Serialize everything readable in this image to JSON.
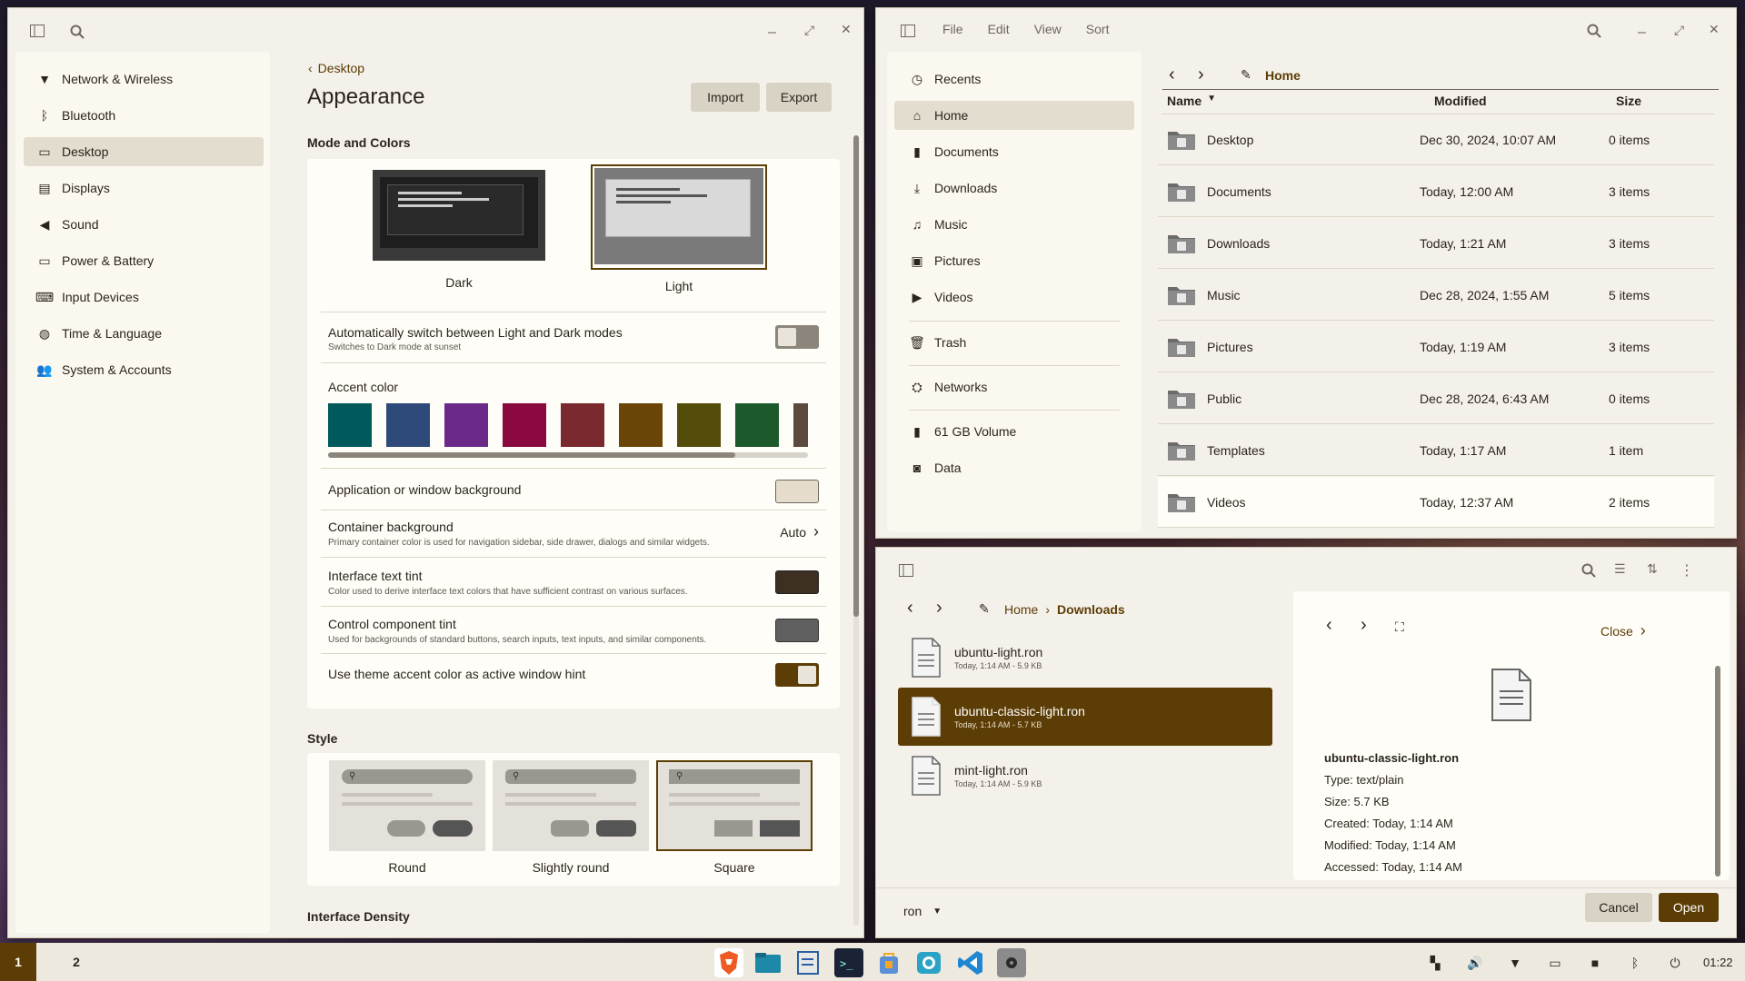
{
  "settings": {
    "nav": [
      {
        "label": "Network & Wireless",
        "icon": "wifi-icon"
      },
      {
        "label": "Bluetooth",
        "icon": "bluetooth-icon"
      },
      {
        "label": "Desktop",
        "icon": "desktop-icon"
      },
      {
        "label": "Displays",
        "icon": "displays-icon"
      },
      {
        "label": "Sound",
        "icon": "sound-icon"
      },
      {
        "label": "Power & Battery",
        "icon": "battery-icon"
      },
      {
        "label": "Input Devices",
        "icon": "keyboard-icon"
      },
      {
        "label": "Time & Language",
        "icon": "globe-icon"
      },
      {
        "label": "System & Accounts",
        "icon": "accounts-icon"
      }
    ],
    "selected_nav": "Desktop",
    "breadcrumb": "Desktop",
    "title": "Appearance",
    "import_label": "Import",
    "export_label": "Export",
    "mode_section": "Mode and Colors",
    "mode_dark": "Dark",
    "mode_light": "Light",
    "selected_mode": "Light",
    "auto_switch_title": "Automatically switch between Light and Dark modes",
    "auto_switch_sub": "Switches to Dark mode at sunset",
    "auto_switch_on": false,
    "accent_label": "Accent color",
    "accent_colors": [
      "#005a5c",
      "#2e4a7a",
      "#6b2a8a",
      "#8a0a3f",
      "#7a2a2e",
      "#6b4507",
      "#544c0a",
      "#1c5a2c",
      "#5c4a3e"
    ],
    "app_bg_label": "Application or window background",
    "app_bg_color": "#e5dccb",
    "container_title": "Container background",
    "container_sub": "Primary container color is used for navigation sidebar, side drawer, dialogs and similar widgets.",
    "container_value": "Auto",
    "text_tint_title": "Interface text tint",
    "text_tint_sub": "Color used to derive interface text colors that have sufficient contrast on various surfaces.",
    "text_tint_color": "#3d3023",
    "control_tint_title": "Control component tint",
    "control_tint_sub": "Used for backgrounds of standard buttons, search inputs, text inputs, and similar components.",
    "control_tint_color": "#5f5f5f",
    "theme_hint_label": "Use theme accent color as active window hint",
    "theme_hint_on": true,
    "style_section": "Style",
    "styles": [
      "Round",
      "Slightly round",
      "Square"
    ],
    "selected_style": "Square",
    "density_section": "Interface Density"
  },
  "files": {
    "menu": [
      "File",
      "Edit",
      "View",
      "Sort"
    ],
    "sidebar": [
      {
        "label": "Recents",
        "icon": "recents-icon"
      },
      {
        "label": "Home",
        "icon": "home-icon"
      },
      {
        "label": "Documents",
        "icon": "documents-icon"
      },
      {
        "label": "Downloads",
        "icon": "downloads-icon"
      },
      {
        "label": "Music",
        "icon": "music-icon"
      },
      {
        "label": "Pictures",
        "icon": "pictures-icon"
      },
      {
        "label": "Videos",
        "icon": "videos-icon"
      },
      {
        "label": "Trash",
        "icon": "trash-icon"
      },
      {
        "label": "Networks",
        "icon": "networks-icon"
      },
      {
        "label": "61 GB Volume",
        "icon": "volume-icon"
      },
      {
        "label": "Data",
        "icon": "drive-icon"
      }
    ],
    "path": "Home",
    "columns": {
      "name": "Name",
      "modified": "Modified",
      "size": "Size"
    },
    "rows": [
      {
        "name": "Desktop",
        "modified": "Dec 30, 2024, 10:07 AM",
        "size": "0 items",
        "icon": "folder-desktop-icon"
      },
      {
        "name": "Documents",
        "modified": "Today, 12:00 AM",
        "size": "3 items",
        "icon": "folder-documents-icon"
      },
      {
        "name": "Downloads",
        "modified": "Today, 1:21 AM",
        "size": "3 items",
        "icon": "folder-downloads-icon"
      },
      {
        "name": "Music",
        "modified": "Dec 28, 2024, 1:55 AM",
        "size": "5 items",
        "icon": "folder-music-icon"
      },
      {
        "name": "Pictures",
        "modified": "Today, 1:19 AM",
        "size": "3 items",
        "icon": "folder-pictures-icon"
      },
      {
        "name": "Public",
        "modified": "Dec 28, 2024, 6:43 AM",
        "size": "0 items",
        "icon": "folder-public-icon"
      },
      {
        "name": "Templates",
        "modified": "Today, 1:17 AM",
        "size": "1 item",
        "icon": "folder-templates-icon"
      },
      {
        "name": "Videos",
        "modified": "Today, 12:37 AM",
        "size": "2 items",
        "icon": "folder-videos-icon"
      }
    ]
  },
  "dialog": {
    "path": [
      "Home",
      "Downloads"
    ],
    "files": [
      {
        "name": "ubuntu-light.ron",
        "meta": "Today, 1:14 AM - 5.9 KB"
      },
      {
        "name": "ubuntu-classic-light.ron",
        "meta": "Today, 1:14 AM - 5.7 KB"
      },
      {
        "name": "mint-light.ron",
        "meta": "Today, 1:14 AM - 5.9 KB"
      }
    ],
    "selected": "ubuntu-classic-light.ron",
    "details": {
      "close_label": "Close",
      "name": "ubuntu-classic-light.ron",
      "type": "Type: text/plain",
      "size": "Size: 5.7 KB",
      "created": "Created: Today, 1:14 AM",
      "modified": "Modified: Today, 1:14 AM",
      "accessed": "Accessed: Today, 1:14 AM"
    },
    "filter": "ron",
    "cancel_label": "Cancel",
    "open_label": "Open"
  },
  "taskbar": {
    "workspaces": [
      "1",
      "2"
    ],
    "active_workspace": "1",
    "apps": [
      "brave-icon",
      "files-icon",
      "editor-icon",
      "terminal-icon",
      "store-icon",
      "camera-icon",
      "vscode-icon",
      "settings-icon"
    ],
    "clock": "01:22"
  },
  "colors": {
    "accent": "#5c3d05",
    "window_bg": "#f4f1ea",
    "card": "#fffdf7"
  }
}
